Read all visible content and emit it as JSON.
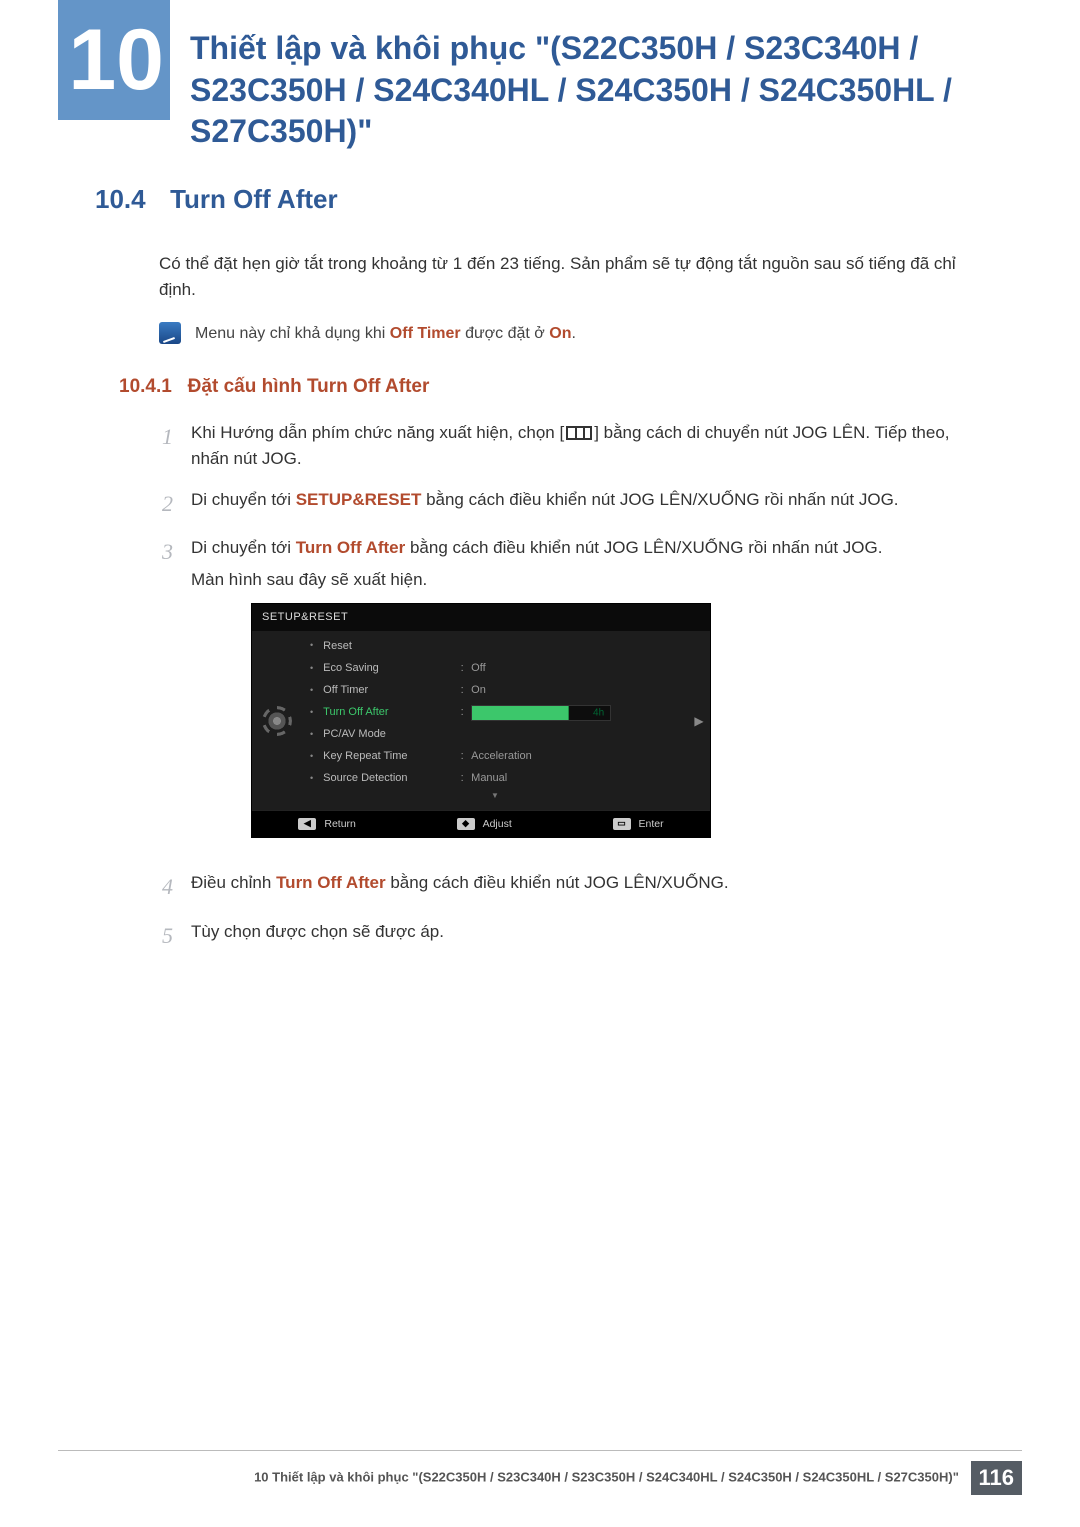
{
  "chapter": {
    "number": "10",
    "title": "Thiết lập và khôi phục \"(S22C350H / S23C340H / S23C350H / S24C340HL / S24C350H / S24C350HL / S27C350H)\""
  },
  "section": {
    "number": "10.4",
    "title": "Turn Off After",
    "intro": "Có thể đặt hẹn giờ tắt trong khoảng từ 1 đến 23 tiếng. Sản phẩm sẽ tự động tắt nguồn sau số tiếng đã chỉ định.",
    "note_pre": "Menu này chỉ khả dụng khi ",
    "note_b1": "Off Timer",
    "note_mid": " được đặt ở ",
    "note_b2": "On",
    "note_end": "."
  },
  "subsection": {
    "number": "10.4.1",
    "title": "Đặt cấu hình Turn Off After"
  },
  "steps": {
    "s1a": "Khi Hướng dẫn phím chức năng xuất hiện, chọn [",
    "s1b": "] bằng cách di chuyển nút JOG LÊN. Tiếp theo, nhấn nút JOG.",
    "s2a": "Di chuyển tới ",
    "s2b": "SETUP&RESET",
    "s2c": " bằng cách điều khiển nút JOG LÊN/XUỐNG rồi nhấn nút JOG.",
    "s3a": "Di chuyển tới ",
    "s3b": "Turn Off After",
    "s3c": " bằng cách điều khiển nút JOG LÊN/XUỐNG rồi nhấn nút JOG.",
    "s3d": "Màn hình sau đây sẽ xuất hiện.",
    "s4a": "Điều chỉnh ",
    "s4b": "Turn Off After",
    "s4c": " bằng cách điều khiển nút JOG LÊN/XUỐNG.",
    "s5": "Tùy chọn được chọn sẽ được áp."
  },
  "osd": {
    "title": "SETUP&RESET",
    "items": [
      {
        "label": "Reset",
        "value": ""
      },
      {
        "label": "Eco Saving",
        "value": "Off"
      },
      {
        "label": "Off Timer",
        "value": "On"
      },
      {
        "label": "Turn Off After",
        "value": "4h",
        "selected": true,
        "slider_pct": 70
      },
      {
        "label": "PC/AV Mode",
        "value": ""
      },
      {
        "label": "Key Repeat Time",
        "value": "Acceleration"
      },
      {
        "label": "Source Detection",
        "value": "Manual"
      }
    ],
    "btn_return": "Return",
    "btn_adjust": "Adjust",
    "btn_enter": "Enter"
  },
  "footer": {
    "text": "10 Thiết lập và khôi phục \"(S22C350H / S23C340H / S23C350H / S24C340HL / S24C350H / S24C350HL / S27C350H)\"",
    "page": "116"
  }
}
